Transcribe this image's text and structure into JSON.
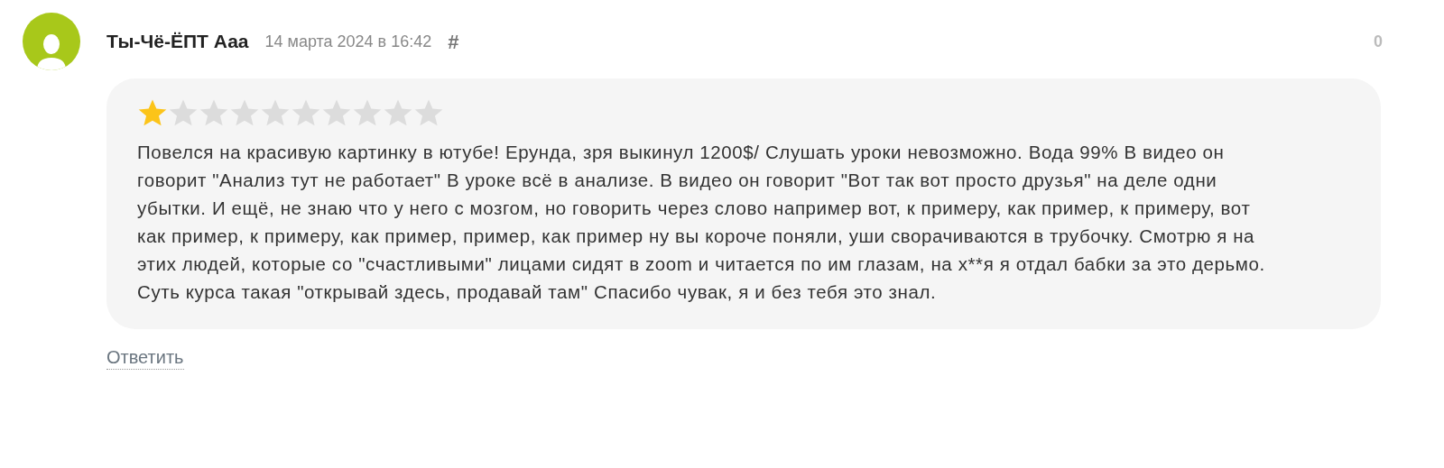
{
  "comment": {
    "author": "Ты-Чё-ЁПТ Ааа",
    "date": "14 марта 2024 в 16:42",
    "anchor": "#",
    "score": "0",
    "stars": 1,
    "text": "Повелся на красивую картинку в ютубе! Ерунда, зря выкинул 1200$/ Слушать уроки невозможно. Вода 99% В видео он говорит \"Анализ тут не работает\" В уроке всё в анализе. В видео он говорит \"Вот так вот просто друзья\" на деле одни убытки. И ещё, не знаю что у него с мозгом, но говорить через слово например вот, к примеру, как пример, к примеру, вот как пример, к примеру, как пример, пример, как пример ну вы короче поняли, уши сворачиваются в трубочку. Смотрю я на этих людей, которые со \"счастливыми\" лицами сидят в zoom и читается по им глазам, на х**я я отдал бабки за это дерьмо. Суть курса такая \"открывай здесь, продавай там\" Спасибо чувак, я и без тебя это знал.",
    "reply": "Ответить"
  }
}
